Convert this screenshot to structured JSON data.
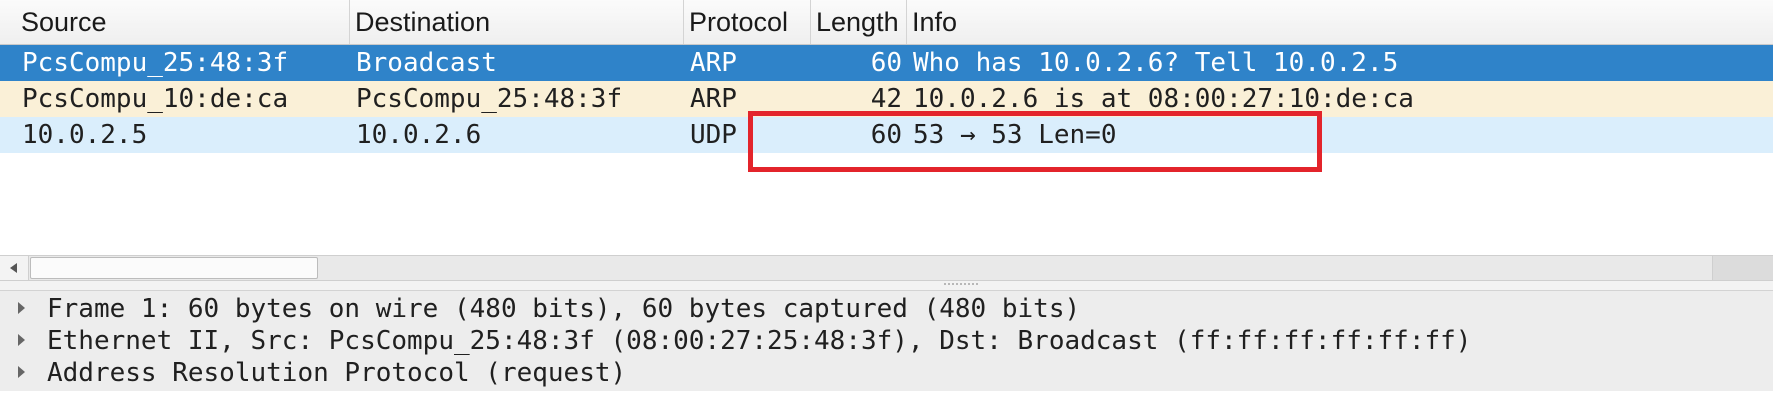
{
  "packet_list": {
    "columns": {
      "source": "Source",
      "destination": "Destination",
      "protocol": "Protocol",
      "length": "Length",
      "info": "Info"
    },
    "rows": [
      {
        "source": "PcsCompu_25:48:3f",
        "destination": "Broadcast",
        "protocol": "ARP",
        "length": "60",
        "info": "Who has 10.0.2.6? Tell 10.0.2.5",
        "selected": true
      },
      {
        "source": "PcsCompu_10:de:ca",
        "destination": "PcsCompu_25:48:3f",
        "protocol": "ARP",
        "length": "42",
        "info": "10.0.2.6 is at 08:00:27:10:de:ca",
        "selected": false
      },
      {
        "source": "10.0.2.5",
        "destination": "10.0.2.6",
        "protocol": "UDP",
        "length": "60",
        "info": "53 → 53 Len=0",
        "selected": false
      }
    ]
  },
  "packet_details": {
    "items": [
      {
        "label": "Frame 1: 60 bytes on wire (480 bits), 60 bytes captured (480 bits)",
        "expanded": false
      },
      {
        "label": "Ethernet II, Src: PcsCompu_25:48:3f (08:00:27:25:48:3f), Dst: Broadcast (ff:ff:ff:ff:ff:ff)",
        "expanded": false
      },
      {
        "label": "Address Resolution Protocol (request)",
        "expanded": false
      }
    ]
  },
  "colors": {
    "selected_row": "#2f83c9",
    "arp_row": "#faf0d7",
    "udp_row": "#daeefc",
    "annotation_box": "#e3242b"
  },
  "icons": {
    "expander": "triangle-right-icon",
    "scroll_left": "arrow-left-icon"
  }
}
